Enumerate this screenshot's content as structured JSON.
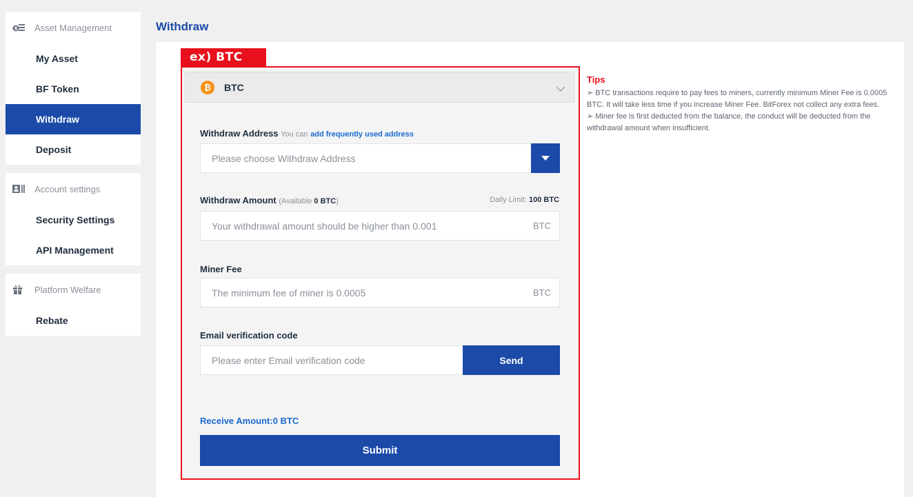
{
  "sidebar": {
    "groups": [
      {
        "header": "Asset Management",
        "icon": "wallet-icon",
        "items": [
          "My Asset",
          "BF Token",
          "Withdraw",
          "Deposit"
        ]
      },
      {
        "header": "Account settings",
        "icon": "account-card-icon",
        "items": [
          "Security Settings",
          "API Management"
        ]
      },
      {
        "header": "Platform Welfare",
        "icon": "gift-icon",
        "items": [
          "Rebate"
        ]
      }
    ],
    "active_item": "Withdraw"
  },
  "page": {
    "title": "Withdraw",
    "example_label": "ex) BTC"
  },
  "coin": {
    "name": "BTC",
    "icon": "bitcoin-icon",
    "icon_glyph": "₿"
  },
  "form": {
    "address": {
      "label": "Withdraw Address",
      "hint": "You can",
      "link": "add frequently used address",
      "placeholder": "Please choose Withdraw Address"
    },
    "amount": {
      "label": "Withdraw Amount",
      "available_prefix": "(Available",
      "available_value": "0 BTC",
      "available_suffix": ")",
      "daily_limit_label": "Daily Limit:",
      "daily_limit_value": "100 BTC",
      "placeholder": "Your withdrawal amount should be higher than 0.001",
      "unit": "BTC"
    },
    "miner_fee": {
      "label": "Miner Fee",
      "placeholder": "The minimum fee of miner is 0.0005",
      "unit": "BTC"
    },
    "email": {
      "label": "Email verification code",
      "placeholder": "Please enter Email verification code",
      "send_label": "Send"
    },
    "receive_amount": "Receive Amount:0 BTC",
    "submit_label": "Submit"
  },
  "tips": {
    "title": "Tips",
    "lines": [
      "➢ BTC transactions require to pay fees to miners, currently minimum Miner Fee is 0.0005 BTC. It will take less time if you increase Miner Fee. BitForex not collect any extra fees.",
      "➢ Miner fee is first deducted from the balance, the conduct will be deducted from the withdrawal amount when insufficient."
    ]
  },
  "colors": {
    "primary": "#1b4aa8",
    "highlight": "#e8101d",
    "link": "#1b6ad0",
    "bitcoin": "#f7931a"
  }
}
